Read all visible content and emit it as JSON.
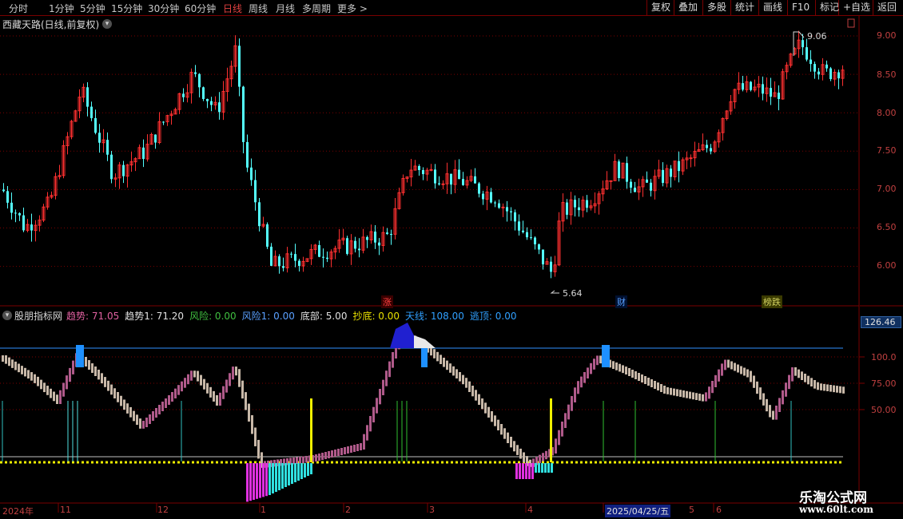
{
  "toolbar": {
    "left": [
      "分时",
      "1分钟",
      "5分钟",
      "15分钟",
      "30分钟",
      "60分钟",
      "日线",
      "周线",
      "月线",
      "多周期",
      "更多 >"
    ],
    "active_index": 6,
    "right": [
      "复权",
      "叠加",
      "多股",
      "统计",
      "画线",
      "F10",
      "+自选",
      "返回"
    ]
  },
  "main_header": {
    "title": "西藏天路(日线,前复权)"
  },
  "main_annotations": {
    "high": "9.06",
    "low": "5.64"
  },
  "main_tags": {
    "zhang": "涨",
    "cai": "财",
    "bangdie": "榜跌"
  },
  "price_axis": [
    "9.00",
    "8.50",
    "8.00",
    "7.50",
    "7.00",
    "6.50",
    "6.00"
  ],
  "indicator_header": {
    "name": "股朋指标网",
    "items": [
      {
        "label": "趋势: 71.05",
        "color": "#e060a0"
      },
      {
        "label": "趋势1: 71.20",
        "color": "#e0e0e0"
      },
      {
        "label": "风险: 0.00",
        "color": "#40c040"
      },
      {
        "label": "风险1: 0.00",
        "color": "#5aa0ff"
      },
      {
        "label": "底部: 5.00",
        "color": "#e0e0e0"
      },
      {
        "label": "抄底: 0.00",
        "color": "#e8e000"
      },
      {
        "label": "天线: 108.00",
        "color": "#30a0ff"
      },
      {
        "label": "逃顶: 0.00",
        "color": "#30a0ff"
      }
    ]
  },
  "indicator_axis": {
    "top_box": "126.46",
    "labels": [
      "100.0",
      "75.00",
      "50.00"
    ]
  },
  "x_axis": {
    "labels": [
      "2024年",
      "11",
      "12",
      "1",
      "2",
      "3",
      "4",
      "5",
      "6"
    ],
    "highlight": "2025/04/25/五"
  },
  "watermark": {
    "line1": "乐淘公式网",
    "line2": "www.60lt.com"
  },
  "colors": {
    "up": "#ff3030",
    "down": "#54ffff",
    "grid": "#7a0000",
    "axis_text": "#c04040"
  }
}
